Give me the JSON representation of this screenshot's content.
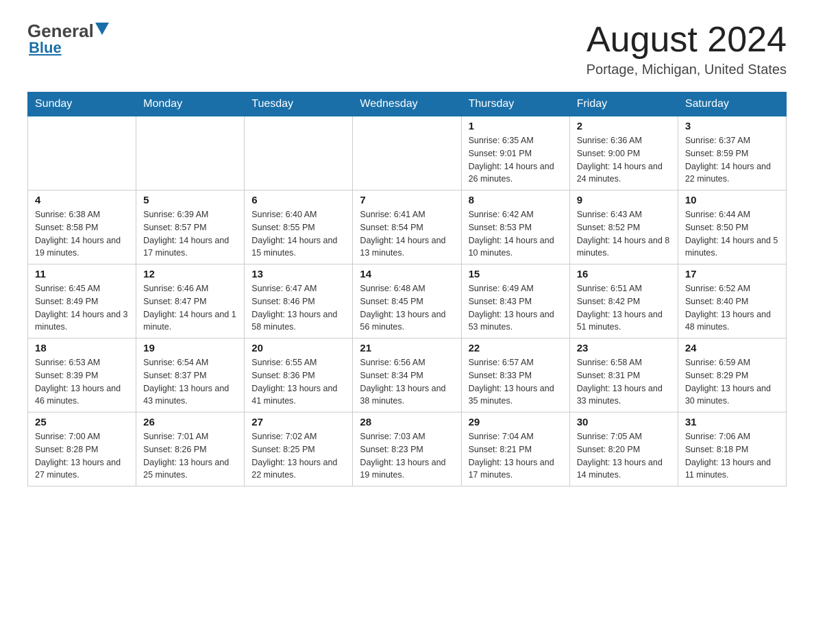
{
  "header": {
    "logo_general": "General",
    "logo_blue": "Blue",
    "title": "August 2024",
    "location": "Portage, Michigan, United States"
  },
  "days_of_week": [
    "Sunday",
    "Monday",
    "Tuesday",
    "Wednesday",
    "Thursday",
    "Friday",
    "Saturday"
  ],
  "weeks": [
    [
      {
        "day": "",
        "info": ""
      },
      {
        "day": "",
        "info": ""
      },
      {
        "day": "",
        "info": ""
      },
      {
        "day": "",
        "info": ""
      },
      {
        "day": "1",
        "info": "Sunrise: 6:35 AM\nSunset: 9:01 PM\nDaylight: 14 hours and 26 minutes."
      },
      {
        "day": "2",
        "info": "Sunrise: 6:36 AM\nSunset: 9:00 PM\nDaylight: 14 hours and 24 minutes."
      },
      {
        "day": "3",
        "info": "Sunrise: 6:37 AM\nSunset: 8:59 PM\nDaylight: 14 hours and 22 minutes."
      }
    ],
    [
      {
        "day": "4",
        "info": "Sunrise: 6:38 AM\nSunset: 8:58 PM\nDaylight: 14 hours and 19 minutes."
      },
      {
        "day": "5",
        "info": "Sunrise: 6:39 AM\nSunset: 8:57 PM\nDaylight: 14 hours and 17 minutes."
      },
      {
        "day": "6",
        "info": "Sunrise: 6:40 AM\nSunset: 8:55 PM\nDaylight: 14 hours and 15 minutes."
      },
      {
        "day": "7",
        "info": "Sunrise: 6:41 AM\nSunset: 8:54 PM\nDaylight: 14 hours and 13 minutes."
      },
      {
        "day": "8",
        "info": "Sunrise: 6:42 AM\nSunset: 8:53 PM\nDaylight: 14 hours and 10 minutes."
      },
      {
        "day": "9",
        "info": "Sunrise: 6:43 AM\nSunset: 8:52 PM\nDaylight: 14 hours and 8 minutes."
      },
      {
        "day": "10",
        "info": "Sunrise: 6:44 AM\nSunset: 8:50 PM\nDaylight: 14 hours and 5 minutes."
      }
    ],
    [
      {
        "day": "11",
        "info": "Sunrise: 6:45 AM\nSunset: 8:49 PM\nDaylight: 14 hours and 3 minutes."
      },
      {
        "day": "12",
        "info": "Sunrise: 6:46 AM\nSunset: 8:47 PM\nDaylight: 14 hours and 1 minute."
      },
      {
        "day": "13",
        "info": "Sunrise: 6:47 AM\nSunset: 8:46 PM\nDaylight: 13 hours and 58 minutes."
      },
      {
        "day": "14",
        "info": "Sunrise: 6:48 AM\nSunset: 8:45 PM\nDaylight: 13 hours and 56 minutes."
      },
      {
        "day": "15",
        "info": "Sunrise: 6:49 AM\nSunset: 8:43 PM\nDaylight: 13 hours and 53 minutes."
      },
      {
        "day": "16",
        "info": "Sunrise: 6:51 AM\nSunset: 8:42 PM\nDaylight: 13 hours and 51 minutes."
      },
      {
        "day": "17",
        "info": "Sunrise: 6:52 AM\nSunset: 8:40 PM\nDaylight: 13 hours and 48 minutes."
      }
    ],
    [
      {
        "day": "18",
        "info": "Sunrise: 6:53 AM\nSunset: 8:39 PM\nDaylight: 13 hours and 46 minutes."
      },
      {
        "day": "19",
        "info": "Sunrise: 6:54 AM\nSunset: 8:37 PM\nDaylight: 13 hours and 43 minutes."
      },
      {
        "day": "20",
        "info": "Sunrise: 6:55 AM\nSunset: 8:36 PM\nDaylight: 13 hours and 41 minutes."
      },
      {
        "day": "21",
        "info": "Sunrise: 6:56 AM\nSunset: 8:34 PM\nDaylight: 13 hours and 38 minutes."
      },
      {
        "day": "22",
        "info": "Sunrise: 6:57 AM\nSunset: 8:33 PM\nDaylight: 13 hours and 35 minutes."
      },
      {
        "day": "23",
        "info": "Sunrise: 6:58 AM\nSunset: 8:31 PM\nDaylight: 13 hours and 33 minutes."
      },
      {
        "day": "24",
        "info": "Sunrise: 6:59 AM\nSunset: 8:29 PM\nDaylight: 13 hours and 30 minutes."
      }
    ],
    [
      {
        "day": "25",
        "info": "Sunrise: 7:00 AM\nSunset: 8:28 PM\nDaylight: 13 hours and 27 minutes."
      },
      {
        "day": "26",
        "info": "Sunrise: 7:01 AM\nSunset: 8:26 PM\nDaylight: 13 hours and 25 minutes."
      },
      {
        "day": "27",
        "info": "Sunrise: 7:02 AM\nSunset: 8:25 PM\nDaylight: 13 hours and 22 minutes."
      },
      {
        "day": "28",
        "info": "Sunrise: 7:03 AM\nSunset: 8:23 PM\nDaylight: 13 hours and 19 minutes."
      },
      {
        "day": "29",
        "info": "Sunrise: 7:04 AM\nSunset: 8:21 PM\nDaylight: 13 hours and 17 minutes."
      },
      {
        "day": "30",
        "info": "Sunrise: 7:05 AM\nSunset: 8:20 PM\nDaylight: 13 hours and 14 minutes."
      },
      {
        "day": "31",
        "info": "Sunrise: 7:06 AM\nSunset: 8:18 PM\nDaylight: 13 hours and 11 minutes."
      }
    ]
  ]
}
